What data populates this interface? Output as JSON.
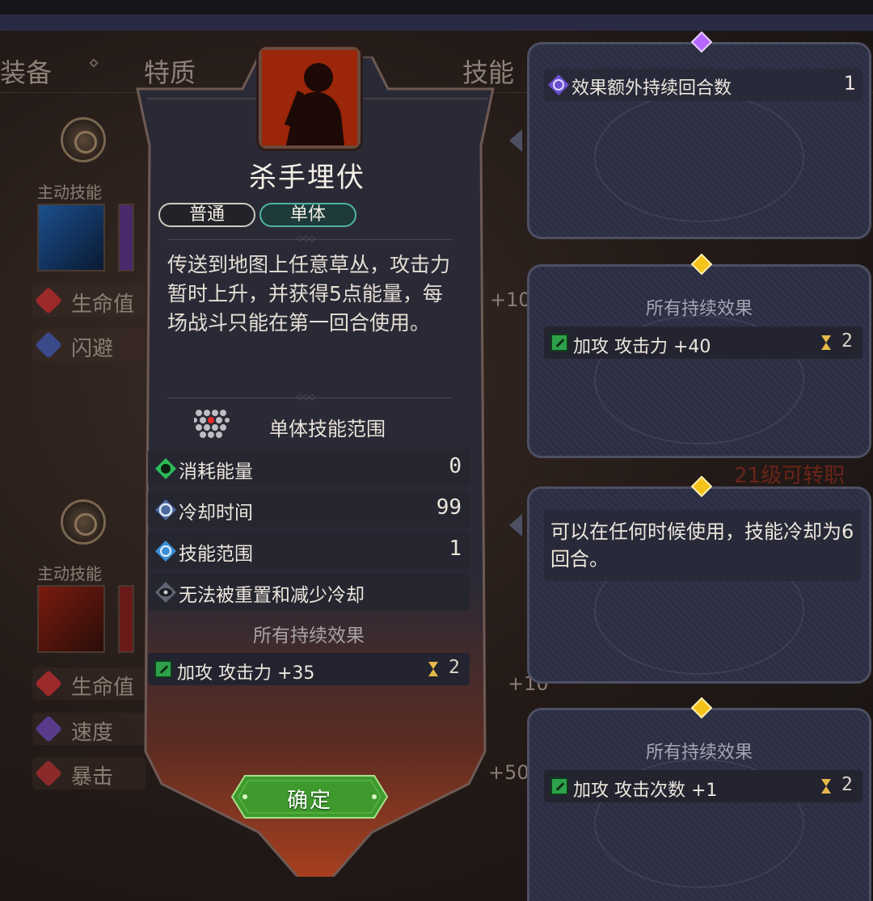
{
  "background": {
    "tabs": [
      "装备",
      "特质",
      "技能"
    ],
    "section1": {
      "category_label": "主动技能",
      "stats": [
        {
          "name": "生命值",
          "value": "+10"
        },
        {
          "name": "闪避",
          "value": ""
        }
      ]
    },
    "section2": {
      "category_label": "主动技能",
      "stats": [
        {
          "name": "生命值",
          "value": "+10"
        },
        {
          "name": "速度",
          "value": ""
        },
        {
          "name": "暴击",
          "value": "+50"
        }
      ]
    },
    "job_change_hint": "21级可转职"
  },
  "skill_popup": {
    "title": "杀手埋伏",
    "tags": [
      "普通",
      "单体"
    ],
    "description": "传送到地图上任意草丛，攻击力暂时上升，并获得5点能量，每场战斗只能在第一回合使用。",
    "range": {
      "label": "单体技能范围"
    },
    "stats": [
      {
        "icon": "energy-icon",
        "label": "消耗能量",
        "value": "0"
      },
      {
        "icon": "cooldown-icon",
        "label": "冷却时间",
        "value": "99"
      },
      {
        "icon": "range-icon",
        "label": "技能范围",
        "value": "1"
      },
      {
        "icon": "eye-icon",
        "label": "无法被重置和减少冷却",
        "value": ""
      }
    ],
    "effects_title": "所有持续效果",
    "effects": [
      {
        "label": "加攻 攻击力 +35",
        "turns": "2"
      }
    ],
    "confirm_label": "确定"
  },
  "tooltips": [
    {
      "gem": "purple",
      "rows": [
        {
          "label": "效果额外持续回合数",
          "value": "1"
        }
      ]
    },
    {
      "gem": "gold",
      "title": "所有持续效果",
      "rows": [
        {
          "label": "加攻 攻击力 +40",
          "turns": "2"
        }
      ]
    },
    {
      "gem": "gold",
      "text": "可以在任何时候使用，技能冷却为6回合。"
    },
    {
      "gem": "gold",
      "title": "所有持续效果",
      "rows": [
        {
          "label": "加攻 攻击次数 +1",
          "turns": "2"
        }
      ]
    }
  ],
  "colors": {
    "accent_green": "#3fa43a",
    "gem_purple": "#b566ff",
    "gem_gold": "#f5c21a",
    "portrait_red": "#8b1f0a"
  }
}
